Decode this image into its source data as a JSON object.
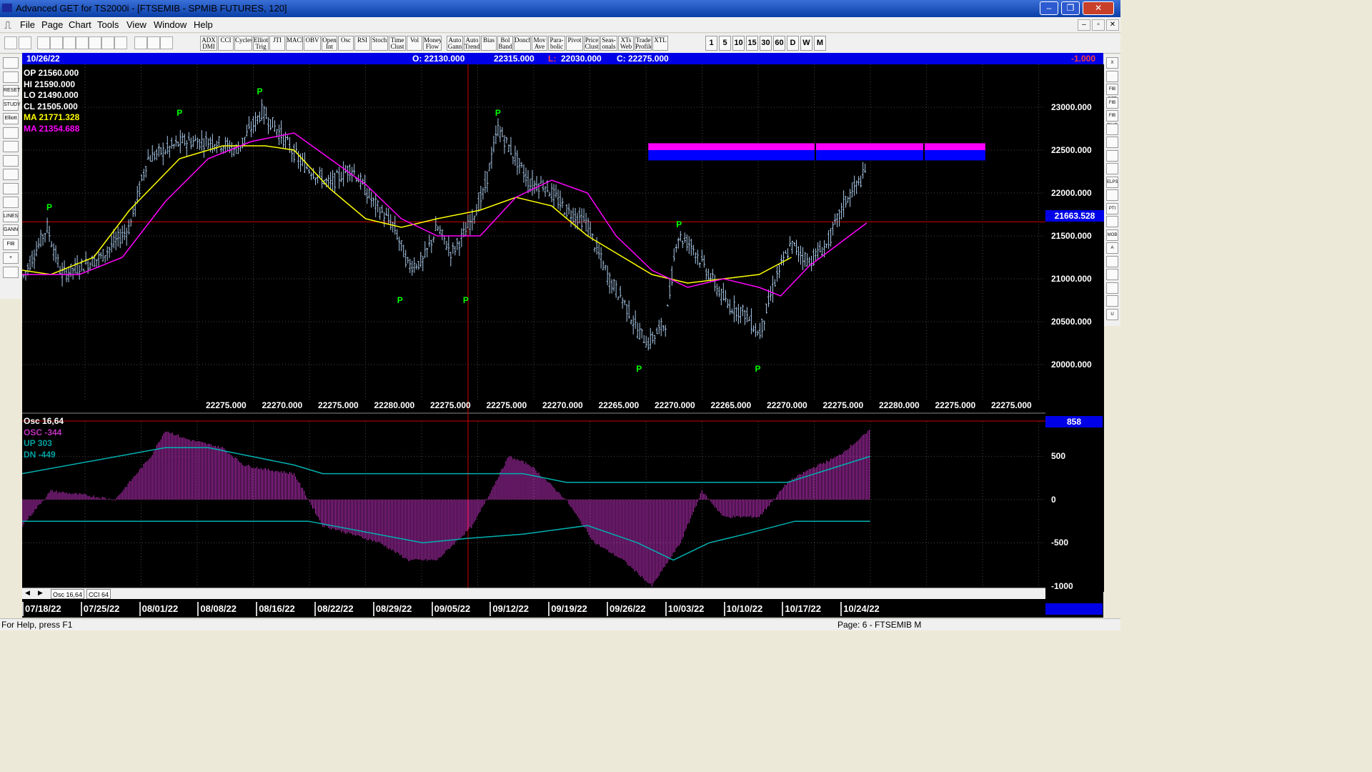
{
  "window": {
    "title": "Advanced GET for TS2000i - [FTSEMIB - SPMIB FUTURES, 120]",
    "controls": {
      "minimize": "–",
      "restore": "❐",
      "close": "✕"
    }
  },
  "menu": {
    "items": [
      "File",
      "Page",
      "Chart",
      "Tools",
      "View",
      "Window",
      "Help"
    ]
  },
  "toolbar": {
    "indicators": [
      "ADX DMI",
      "CCI",
      "Cycles",
      "Elliott Trig",
      "JTI",
      "MACD",
      "OBV",
      "Open Int",
      "Osc",
      "RSI",
      "Stoch",
      "Time Clust",
      "Vol",
      "Money Flow",
      "Auto Gann",
      "Auto Trend",
      "Bias",
      "Bol Band",
      "Donch",
      "Mov Ave",
      "Para- bolic",
      "Pivot",
      "Price Clust",
      "Seas- onals",
      "XTs Web",
      "Trade Profile",
      "XTL"
    ],
    "timeframes": [
      "1",
      "5",
      "10",
      "15",
      "30",
      "60",
      "D",
      "W",
      "M"
    ]
  },
  "left_tools": [
    "",
    "",
    "RESET",
    "STUDY",
    "Elliott",
    "",
    "",
    "",
    "",
    "",
    "",
    "LINES",
    "GANN",
    "FIB",
    "+",
    ""
  ],
  "right_tools": [
    "X",
    "",
    "FIB RET",
    "FIB EXT",
    "FIB TIME",
    "",
    "",
    "",
    "",
    "ELPS",
    "",
    "PTI",
    "",
    "MOB",
    "A",
    "",
    "",
    "",
    "",
    "U"
  ],
  "header": {
    "date": "10/26/22",
    "open": "O: 22130.000",
    "high": "22315.000",
    "low_label": "L:",
    "low": "22030.000",
    "close": "C: 22275.000",
    "change": "-1.000"
  },
  "legend": {
    "op": "OP  21560.000",
    "hi": "HI   21590.000",
    "lo": "LO  21490.000",
    "cl": "CL  21505.000",
    "ma1": "MA  21771.328",
    "ma2": "MA  21354.688"
  },
  "osc_legend": {
    "title": "Osc 16,64",
    "osc": "OSC -344",
    "up": "UP   303",
    "dn": "DN   -449"
  },
  "price_scale": {
    "labels": [
      "23000.000",
      "22500.000",
      "22000.000",
      "21500.000",
      "21000.000",
      "20500.000",
      "20000.000"
    ],
    "current": "21663.528"
  },
  "osc_scale": {
    "labels": [
      "500",
      "0",
      "-500",
      "-1000"
    ],
    "current": "858"
  },
  "x_labels": [
    "22275.000",
    "22270.000",
    "22275.000",
    "22280.000",
    "22275.000",
    "22275.000",
    "22270.000",
    "22265.000",
    "22270.000",
    "22265.000",
    "22270.000",
    "22275.000",
    "22280.000",
    "22275.000",
    "22275.000"
  ],
  "pivot_label": "P",
  "tabs": [
    "Osc 16,64",
    "CCI 64"
  ],
  "dates": [
    "07/18/22",
    "07/25/22",
    "08/01/22",
    "08/08/22",
    "08/16/22",
    "08/22/22",
    "08/29/22",
    "09/05/22",
    "09/12/22",
    "09/19/22",
    "09/26/22",
    "10/03/22",
    "10/10/22",
    "10/17/22",
    "10/24/22"
  ],
  "status": {
    "help": "For Help, press F1",
    "page": "Page: 6 - FTSEMIB M"
  },
  "colors": {
    "bars": "#a8c8e8",
    "ma1": "#ffff00",
    "ma2": "#ff00ff",
    "pivot": "#00ff00",
    "osc": "#c030c0",
    "band": "#00b0b0",
    "header": "#0000e6",
    "hline": "#cc0000"
  },
  "chart_data": {
    "type": "ohlc",
    "price_range": [
      19500,
      23500
    ],
    "anchors": [
      [
        0,
        21000
      ],
      [
        35,
        21600
      ],
      [
        55,
        21050
      ],
      [
        110,
        21250
      ],
      [
        150,
        21600
      ],
      [
        175,
        22400
      ],
      [
        225,
        22600
      ],
      [
        270,
        22600
      ],
      [
        300,
        22500
      ],
      [
        335,
        22950
      ],
      [
        360,
        22700
      ],
      [
        390,
        22350
      ],
      [
        430,
        22100
      ],
      [
        460,
        22300
      ],
      [
        490,
        21900
      ],
      [
        520,
        21600
      ],
      [
        540,
        21150
      ],
      [
        560,
        21200
      ],
      [
        580,
        21600
      ],
      [
        600,
        21300
      ],
      [
        620,
        21550
      ],
      [
        645,
        22000
      ],
      [
        665,
        22750
      ],
      [
        690,
        22400
      ],
      [
        710,
        22100
      ],
      [
        730,
        22100
      ],
      [
        760,
        21800
      ],
      [
        790,
        21650
      ],
      [
        800,
        21400
      ],
      [
        820,
        21000
      ],
      [
        840,
        20750
      ],
      [
        860,
        20400
      ],
      [
        875,
        20250
      ],
      [
        900,
        20500
      ],
      [
        915,
        21500
      ],
      [
        935,
        21400
      ],
      [
        960,
        21050
      ],
      [
        985,
        20700
      ],
      [
        1010,
        20600
      ],
      [
        1030,
        20350
      ],
      [
        1055,
        21050
      ],
      [
        1075,
        21400
      ],
      [
        1100,
        21200
      ],
      [
        1125,
        21400
      ],
      [
        1150,
        21900
      ],
      [
        1180,
        22250
      ]
    ],
    "ma_fast": [
      [
        0,
        21100
      ],
      [
        40,
        21050
      ],
      [
        100,
        21250
      ],
      [
        150,
        21800
      ],
      [
        220,
        22400
      ],
      [
        280,
        22550
      ],
      [
        340,
        22550
      ],
      [
        380,
        22500
      ],
      [
        430,
        22050
      ],
      [
        480,
        21700
      ],
      [
        530,
        21600
      ],
      [
        580,
        21700
      ],
      [
        640,
        21800
      ],
      [
        690,
        21950
      ],
      [
        740,
        21850
      ],
      [
        790,
        21500
      ],
      [
        830,
        21300
      ],
      [
        880,
        21050
      ],
      [
        930,
        20950
      ],
      [
        980,
        21000
      ],
      [
        1030,
        21050
      ],
      [
        1075,
        21250
      ]
    ],
    "ma_slow": [
      [
        0,
        21050
      ],
      [
        80,
        21050
      ],
      [
        140,
        21250
      ],
      [
        200,
        21900
      ],
      [
        260,
        22400
      ],
      [
        320,
        22600
      ],
      [
        380,
        22700
      ],
      [
        430,
        22400
      ],
      [
        480,
        22100
      ],
      [
        530,
        21700
      ],
      [
        580,
        21500
      ],
      [
        640,
        21500
      ],
      [
        690,
        21950
      ],
      [
        740,
        22150
      ],
      [
        790,
        22000
      ],
      [
        830,
        21500
      ],
      [
        880,
        21100
      ],
      [
        930,
        20900
      ],
      [
        980,
        21000
      ],
      [
        1030,
        20900
      ],
      [
        1060,
        20800
      ],
      [
        1100,
        21150
      ],
      [
        1180,
        21650
      ]
    ],
    "pivots": [
      [
        38,
        21750,
        "h"
      ],
      [
        220,
        22850,
        "h"
      ],
      [
        332,
        23100,
        "h"
      ],
      [
        528,
        20850,
        "l"
      ],
      [
        620,
        20850,
        "l"
      ],
      [
        665,
        22850,
        "h"
      ],
      [
        862,
        20050,
        "l"
      ],
      [
        918,
        21550,
        "h"
      ],
      [
        1028,
        20050,
        "l"
      ]
    ],
    "resistance": {
      "price_top": 22580,
      "price_mid": 22500,
      "price_bottom": 22380,
      "from": 875,
      "to": 1346
    },
    "hline_price": 21663.528,
    "osc": [
      [
        0,
        -300
      ],
      [
        40,
        100
      ],
      [
        90,
        50
      ],
      [
        130,
        0
      ],
      [
        180,
        500
      ],
      [
        200,
        800
      ],
      [
        230,
        700
      ],
      [
        280,
        600
      ],
      [
        310,
        400
      ],
      [
        340,
        350
      ],
      [
        380,
        300
      ],
      [
        420,
        -300
      ],
      [
        460,
        -400
      ],
      [
        500,
        -500
      ],
      [
        540,
        -700
      ],
      [
        580,
        -700
      ],
      [
        630,
        -300
      ],
      [
        680,
        500
      ],
      [
        710,
        400
      ],
      [
        760,
        0
      ],
      [
        800,
        -500
      ],
      [
        840,
        -700
      ],
      [
        880,
        -1000
      ],
      [
        920,
        -500
      ],
      [
        950,
        100
      ],
      [
        980,
        -200
      ],
      [
        1030,
        -200
      ],
      [
        1070,
        200
      ],
      [
        1100,
        350
      ],
      [
        1140,
        500
      ],
      [
        1185,
        800
      ]
    ],
    "band_up": [
      [
        0,
        300
      ],
      [
        200,
        600
      ],
      [
        260,
        600
      ],
      [
        320,
        500
      ],
      [
        380,
        400
      ],
      [
        420,
        300
      ],
      [
        700,
        300
      ],
      [
        760,
        200
      ],
      [
        950,
        200
      ],
      [
        980,
        200
      ],
      [
        1070,
        200
      ],
      [
        1185,
        500
      ]
    ],
    "band_dn": [
      [
        0,
        -250
      ],
      [
        400,
        -250
      ],
      [
        560,
        -500
      ],
      [
        620,
        -450
      ],
      [
        700,
        -400
      ],
      [
        790,
        -300
      ],
      [
        860,
        -500
      ],
      [
        910,
        -700
      ],
      [
        960,
        -500
      ],
      [
        1010,
        -400
      ],
      [
        1080,
        -250
      ],
      [
        1185,
        -250
      ]
    ],
    "osc_range": [
      -1050,
      900
    ],
    "x_range": [
      0,
      1430
    ]
  }
}
